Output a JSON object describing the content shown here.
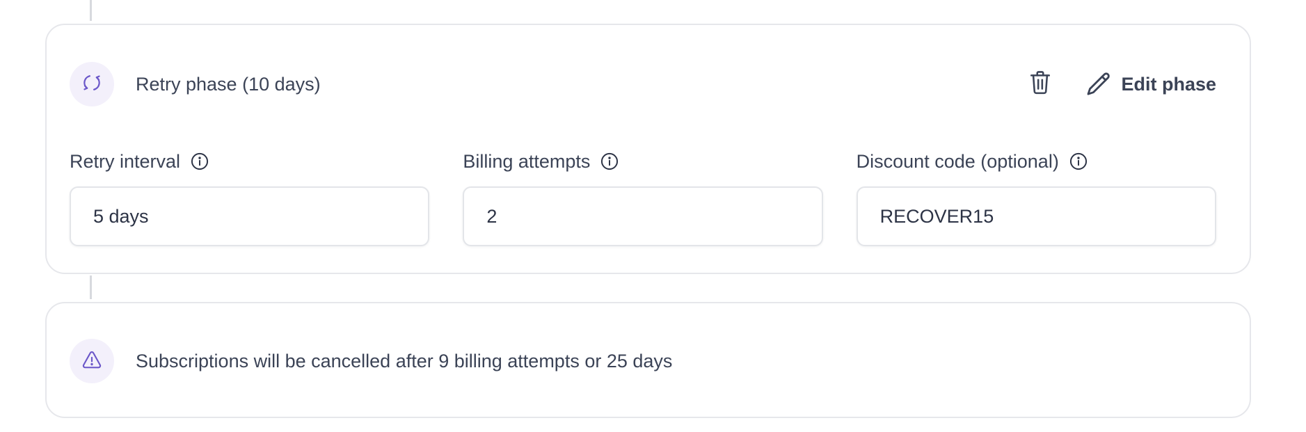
{
  "phase": {
    "title": "Retry phase (10 days)",
    "icon": "refresh-icon",
    "delete_icon": "trash-icon",
    "edit_label": "Edit phase",
    "edit_icon": "pencil-icon",
    "fields": [
      {
        "label": "Retry interval",
        "value": "5 days"
      },
      {
        "label": "Billing attempts",
        "value": "2"
      },
      {
        "label": "Discount code (optional)",
        "value": "RECOVER15"
      }
    ]
  },
  "notice": {
    "icon": "warning-icon",
    "text": "Subscriptions will be cancelled after 9 billing attempts or 25 days"
  },
  "colors": {
    "accent": "#6b57c9",
    "accent_bg": "#f3f0fb",
    "text": "#3b4356",
    "border": "#e6e7eb"
  }
}
